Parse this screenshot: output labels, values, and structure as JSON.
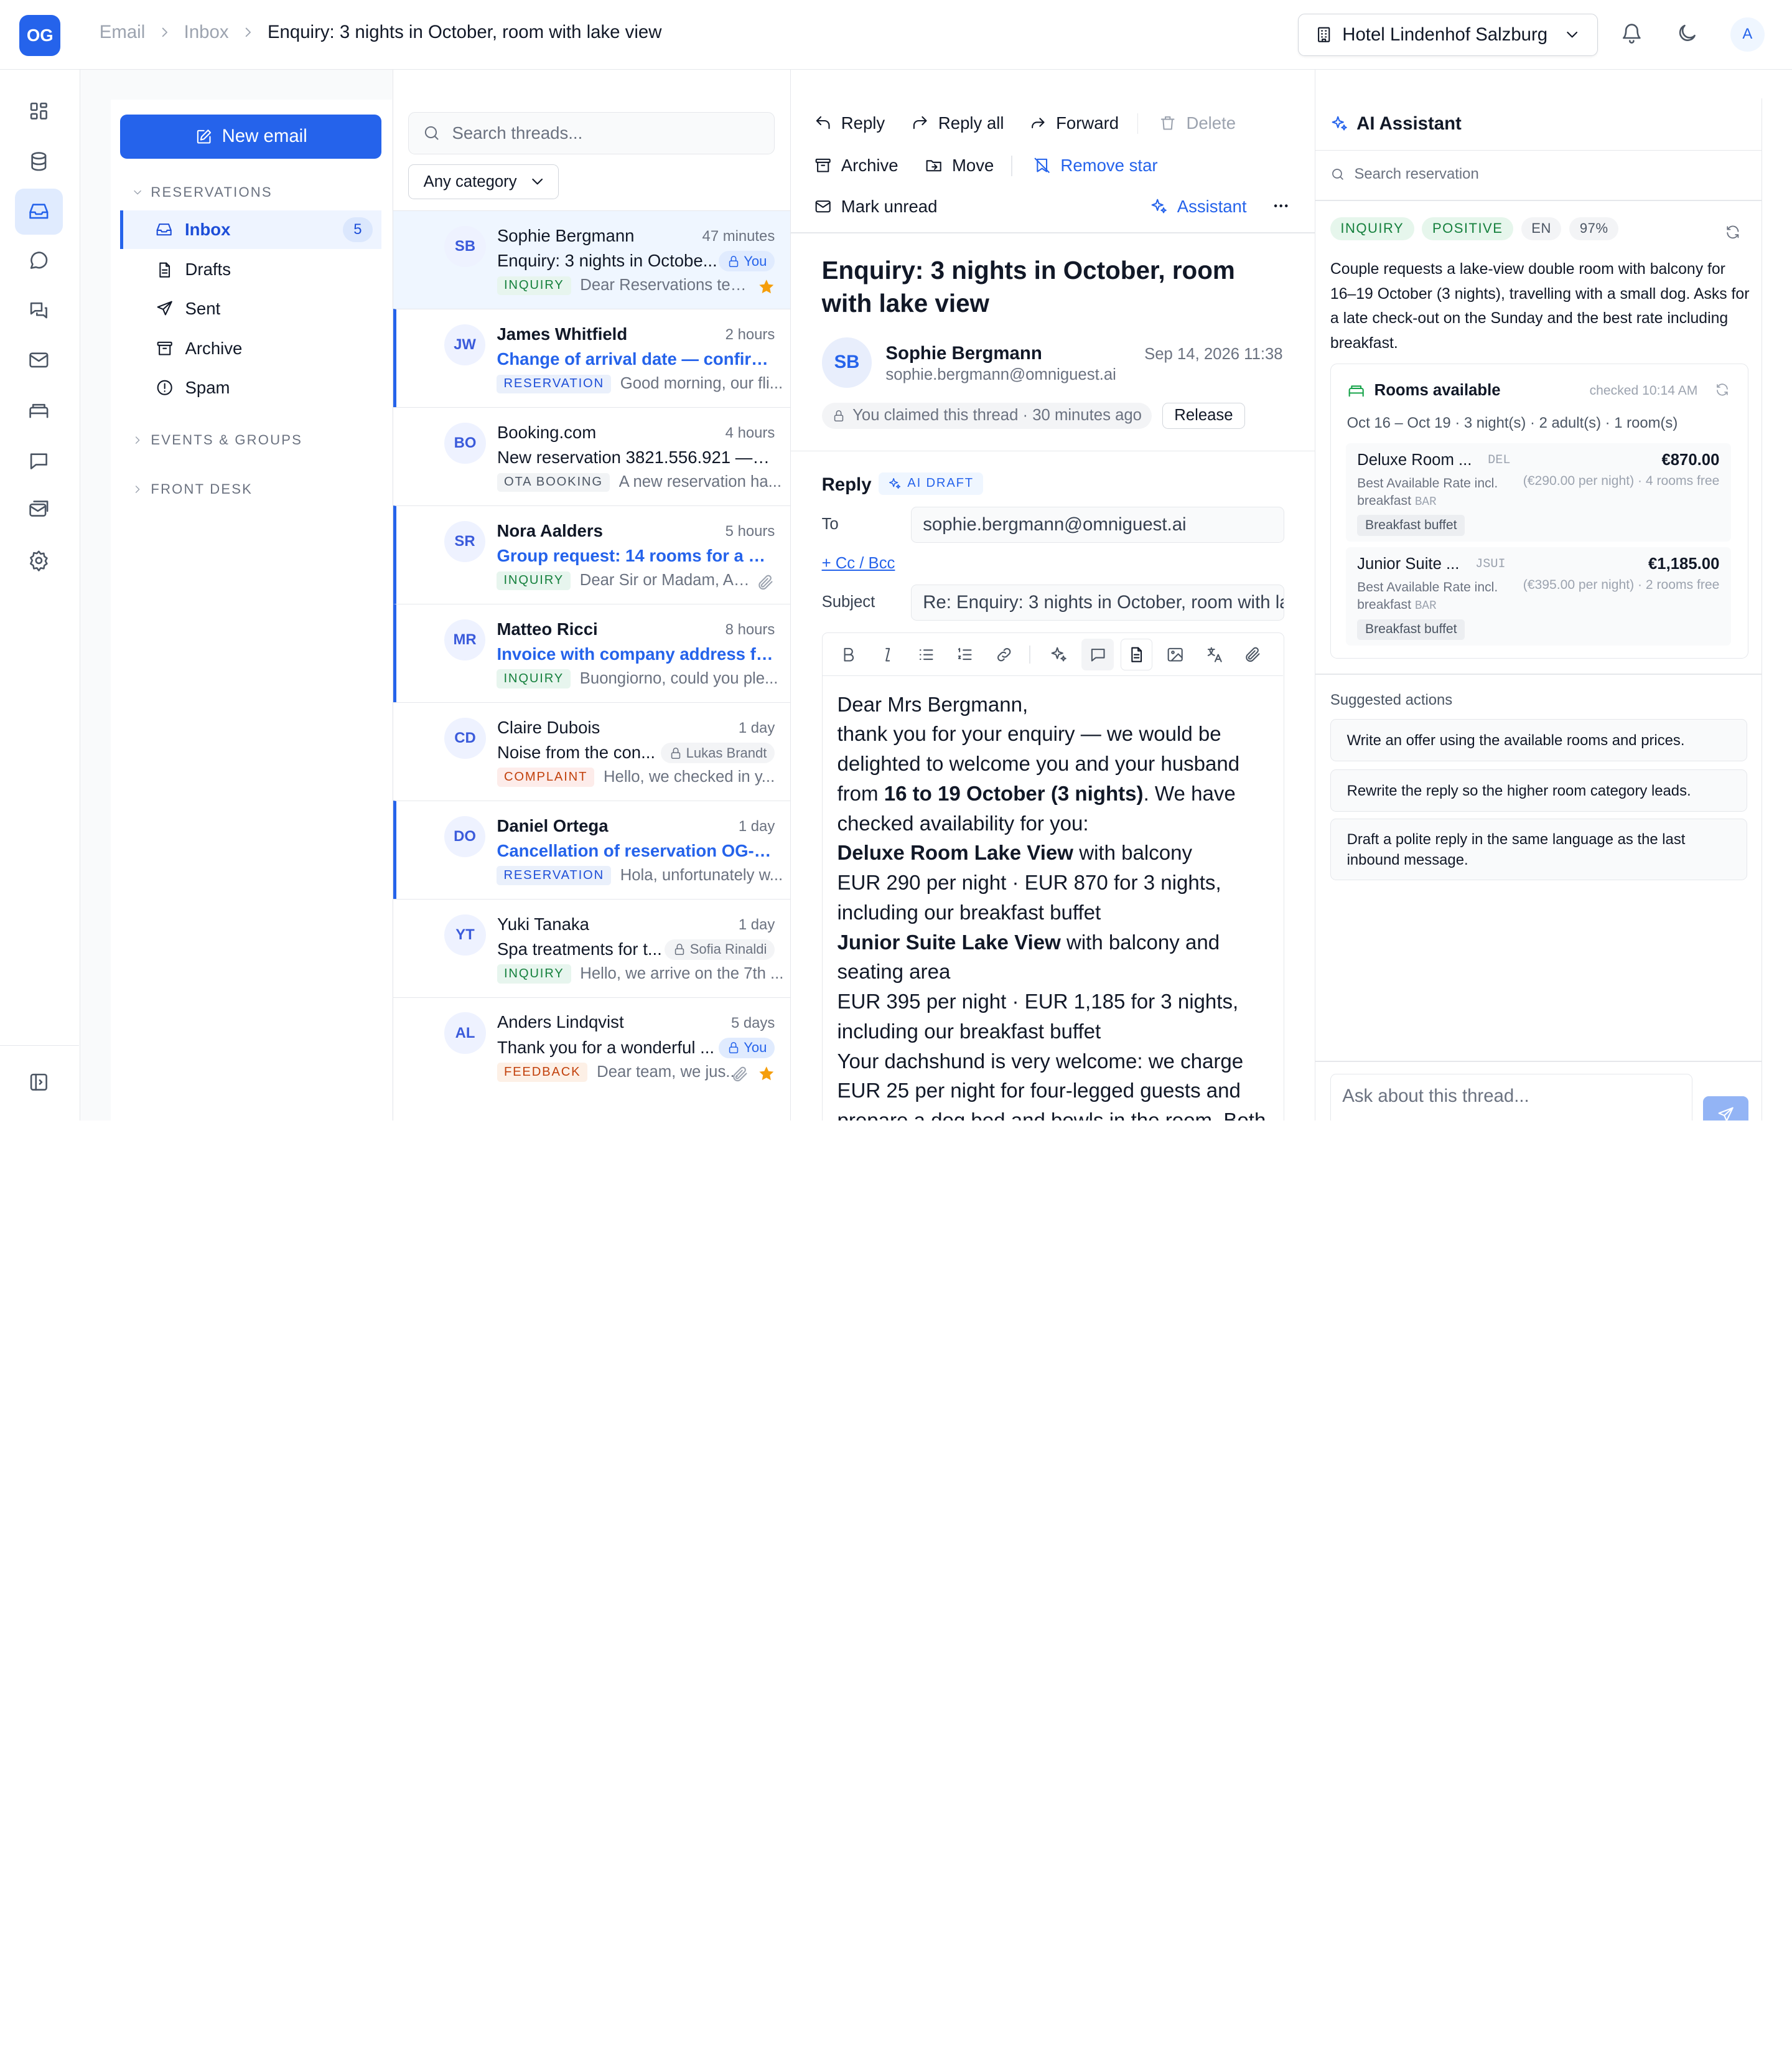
{
  "app": {
    "logo": "OG"
  },
  "breadcrumb": [
    "Email",
    "Inbox",
    "Enquiry: 3 nights in October, room with lake view"
  ],
  "hotel_selector": {
    "label": "Hotel Lindenhof Salzburg"
  },
  "user": {
    "avatar": "A"
  },
  "compose": {
    "label": "New email"
  },
  "sections": {
    "reservations": "RESERVATIONS",
    "events": "EVENTS & GROUPS",
    "front_desk": "FRONT DESK"
  },
  "folders": [
    {
      "label": "Inbox",
      "count": "5",
      "icon": "inbox-icon"
    },
    {
      "label": "Drafts",
      "icon": "file-icon"
    },
    {
      "label": "Sent",
      "icon": "send-icon"
    },
    {
      "label": "Archive",
      "icon": "archive-icon"
    },
    {
      "label": "Spam",
      "icon": "alert-icon"
    }
  ],
  "thread_list": {
    "search_placeholder": "Search threads...",
    "category": "Any category",
    "threads": [
      {
        "initials": "SB",
        "name": "Sophie Bergmann",
        "time": "47 minutes",
        "subject": "Enquiry: 3 nights in Octobe...",
        "lock": "You",
        "tag": "INQUIRY",
        "preview": "Dear Reservations tea..."
      },
      {
        "initials": "JW",
        "name": "James Whitfield",
        "time": "2 hours",
        "subject": "Change of arrival date — confirm...",
        "tag": "RESERVATION",
        "preview": "Good morning, our fli..."
      },
      {
        "initials": "BO",
        "name": "Booking.com",
        "time": "4 hours",
        "subject": "New reservation 3821.556.921 — 2...",
        "tag": "OTA BOOKING",
        "preview": "A new reservation ha..."
      },
      {
        "initials": "SR",
        "name": "Nora Aalders",
        "time": "5 hours",
        "subject": "Group request: 14 rooms for a co...",
        "tag": "INQUIRY",
        "preview": "Dear Sir or Madam, Aal..."
      },
      {
        "initials": "MR",
        "name": "Matteo Ricci",
        "time": "8 hours",
        "subject": "Invoice with company address fo...",
        "tag": "INQUIRY",
        "preview": "Buongiorno, could you ple..."
      },
      {
        "initials": "CD",
        "name": "Claire Dubois",
        "time": "1 day",
        "subject": "Noise from the con...",
        "lock": "Lukas Brandt",
        "tag": "COMPLAINT",
        "preview": "Hello, we checked in y..."
      },
      {
        "initials": "DO",
        "name": "Daniel Ortega",
        "time": "1 day",
        "subject": "Cancellation of reservation OG-4...",
        "tag": "RESERVATION",
        "preview": "Hola, unfortunately w..."
      },
      {
        "initials": "YT",
        "name": "Yuki Tanaka",
        "time": "1 day",
        "subject": "Spa treatments for t...",
        "lock": "Sofia Rinaldi",
        "tag": "INQUIRY",
        "preview": "Hello, we arrive on the 7th ..."
      },
      {
        "initials": "AL",
        "name": "Anders Lindqvist",
        "time": "5 days",
        "subject": "Thank you for a wonderful ...",
        "lock": "You",
        "tag": "FEEDBACK",
        "preview": "Dear team, we jus..."
      }
    ]
  },
  "toolbar": {
    "reply": "Reply",
    "reply_all": "Reply all",
    "forward": "Forward",
    "delete": "Delete",
    "archive": "Archive",
    "move": "Move",
    "remove_star": "Remove star",
    "mark_unread": "Mark unread",
    "assistant": "Assistant"
  },
  "message": {
    "title": "Enquiry: 3 nights in October, room with lake view",
    "sender_initials": "SB",
    "sender_name": "Sophie Bergmann",
    "sender_email": "sophie.bergmann@omniguest.ai",
    "date": "Sep 14, 2026 11:38",
    "claim_text": "You claimed this thread · 30 minutes ago",
    "release": "Release"
  },
  "reply": {
    "label": "Reply",
    "badge": "AI DRAFT",
    "to_label": "To",
    "to": "sophie.bergmann@omniguest.ai",
    "cc": "+ Cc / Bcc",
    "subject_label": "Subject",
    "subject": "Re: Enquiry: 3 nights in October, room with lake view",
    "body": {
      "greeting": "Dear Mrs Bergmann,",
      "p1a": "thank you for your enquiry — we would be delighted to welcome you and your husband from ",
      "p1b": "16 to 19 October (3 nights)",
      "p1c": ". We have checked availability for you:",
      "r1name": "Deluxe Room Lake View",
      "r1rest": " with balcony",
      "r1price": "EUR 290 per night · EUR 870 for 3 nights, including our breakfast buffet",
      "r2name": "Junior Suite Lake View",
      "r2rest": " with balcony and seating area",
      "r2price": "EUR 395 per night · EUR 1,185 for 3 nights, including our breakfast buffet",
      "dog": "Your dachshund is very welcome: we charge EUR 25 per night for four-legged guests and prepare a dog bed and bowls in the room. Both"
    }
  },
  "ai": {
    "title": "AI Assistant",
    "search_placeholder": "Search reservation",
    "chips": [
      "INQUIRY",
      "POSITIVE",
      "EN",
      "97%"
    ],
    "summary": "Couple requests a lake-view double room with balcony for 16–19 October (3 nights), travelling with a small dog. Asks for a late check-out on the Sunday and the best rate including breakfast.",
    "rooms": {
      "title": "Rooms available",
      "checked": "checked 10:14 AM",
      "dates": "Oct 16 – Oct 19 · 3 night(s) · 2 adult(s) · 1 room(s)",
      "items": [
        {
          "name": "Deluxe Room ...",
          "code": "DEL",
          "price": "€870.00",
          "rate": "Best Available Rate incl. breakfast",
          "rate_code": "BAR",
          "per_night": "(€290.00 per night) · 4 rooms free",
          "board": "Breakfast buffet"
        },
        {
          "name": "Junior Suite ...",
          "code": "JSUI",
          "price": "€1,185.00",
          "rate": "Best Available Rate incl. breakfast",
          "rate_code": "BAR",
          "per_night": "(€395.00 per night) · 2 rooms free",
          "board": "Breakfast buffet"
        }
      ]
    },
    "suggested_label": "Suggested actions",
    "suggested": [
      "Write an offer using the available rooms and prices.",
      "Rewrite the reply so the higher room category leads.",
      "Draft a polite reply in the same language as the last inbound message."
    ],
    "ask_placeholder": "Ask about this thread..."
  },
  "colors": {
    "accent": "#2563eb",
    "inquiry": "#15803d",
    "complaint": "#c2410c",
    "star": "#f59e0b"
  }
}
